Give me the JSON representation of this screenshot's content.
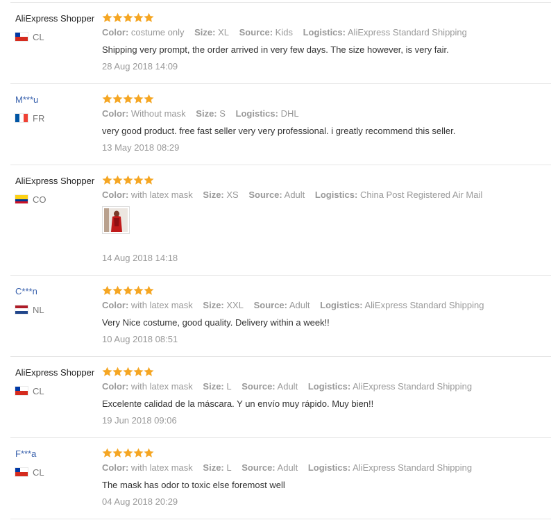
{
  "labels": {
    "color": "Color:",
    "size": "Size:",
    "source": "Source:",
    "logistics": "Logistics:"
  },
  "star_color": "#f5a623",
  "reviews": [
    {
      "user": "AliExpress Shopper",
      "country": "CL",
      "rating": 5,
      "color": "costume only",
      "size": "XL",
      "source": "Kids",
      "logistics": "AliExpress Standard Shipping",
      "text": "Shipping very prompt, the order arrived in very few days. The size however, is very fair.",
      "date": "28 Aug 2018 14:09"
    },
    {
      "user": "M***u",
      "country": "FR",
      "rating": 5,
      "color": "Without mask",
      "size": "S",
      "logistics": "DHL",
      "text": "very good product. free fast seller very very professional. i greatly recommend this seller.",
      "date": "13 May 2018 08:29"
    },
    {
      "user": "AliExpress Shopper",
      "country": "CO",
      "rating": 5,
      "color": "with latex mask",
      "size": "XS",
      "source": "Adult",
      "logistics": "China Post Registered Air Mail",
      "photo": "review-photo",
      "date": "14 Aug 2018 14:18"
    },
    {
      "user": "C***n",
      "country": "NL",
      "rating": 5,
      "color": "with latex mask",
      "size": "XXL",
      "source": "Adult",
      "logistics": "AliExpress Standard Shipping",
      "text": "Very Nice costume, good quality. Delivery within a week!!",
      "date": "10 Aug 2018 08:51"
    },
    {
      "user": "AliExpress Shopper",
      "country": "CL",
      "rating": 5,
      "color": "with latex mask",
      "size": "L",
      "source": "Adult",
      "logistics": "AliExpress Standard Shipping",
      "text": "Excelente calidad de la máscara. Y un envío muy rápido. Muy bien!!",
      "date": "19 Jun 2018 09:06"
    },
    {
      "user": "F***a",
      "country": "CL",
      "rating": 5,
      "color": "with latex mask",
      "size": "L",
      "source": "Adult",
      "logistics": "AliExpress Standard Shipping",
      "text": "The mask has odor to toxic else foremost well",
      "date": "04 Aug 2018 20:29"
    }
  ]
}
